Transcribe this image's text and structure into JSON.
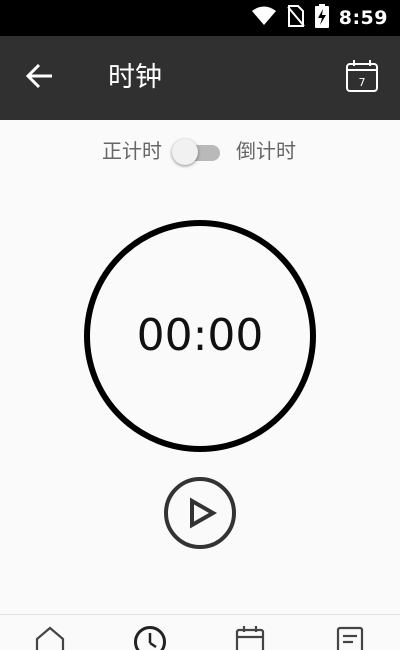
{
  "status_bar": {
    "time": "8:59",
    "icons": [
      "wifi-icon",
      "no-sim-icon",
      "battery-charging-icon"
    ]
  },
  "app_bar": {
    "back_icon": "arrow-back-icon",
    "title": "时钟",
    "calendar_icon": "calendar-icon",
    "calendar_day": "7"
  },
  "mode_toggle": {
    "left_label": "正计时",
    "right_label": "倒计时",
    "state": "off"
  },
  "timer": {
    "display": "00:00"
  },
  "controls": {
    "play_icon": "play-icon"
  },
  "bottom_nav": {
    "items": [
      "home-icon",
      "clock-icon",
      "calendar-icon",
      "notes-icon"
    ],
    "active": "clock-icon"
  },
  "colors": {
    "status_bar": "#000000",
    "app_bar": "#303030",
    "background": "#fafafa",
    "switch_track": "#b9b9b9",
    "icon_dark": "#333333"
  }
}
